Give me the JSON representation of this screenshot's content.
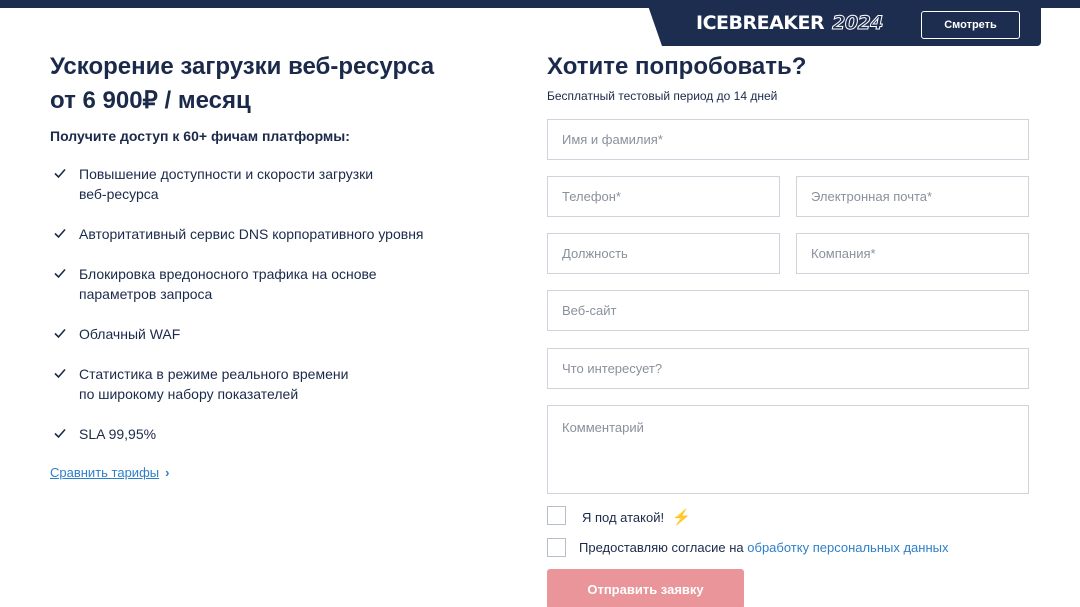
{
  "banner": {
    "logo_text": "ICEBREAKER",
    "logo_year": "2024",
    "watch_label": "Смотреть"
  },
  "offer": {
    "title_line1": "Ускорение загрузки веб-ресурса",
    "title_line2": "от 6 900₽ / месяц",
    "features_heading": "Получите доступ к 60+ фичам платформы:",
    "features": [
      [
        "Повышение доступности и скорости загрузки",
        "веб-ресурса"
      ],
      [
        "Авторитативный сервис DNS корпоративного уровня"
      ],
      [
        "Блокировка вредоносного трафика на основе",
        "параметров запроса"
      ],
      [
        "Облачный WAF"
      ],
      [
        "Статистика в режиме реального времени",
        "по широкому набору показателей"
      ],
      [
        "SLA 99,95%"
      ]
    ],
    "compare_link": "Сравнить тарифы",
    "compare_chevron": "›"
  },
  "form": {
    "title": "Хотите попробовать?",
    "subtitle": "Бесплатный тестовый период до 14 дней",
    "fields": {
      "name": "Имя и фамилия*",
      "phone": "Телефон*",
      "email": "Электронная почта*",
      "position": "Должность",
      "company": "Компания*",
      "website": "Веб-сайт",
      "interest": "Что интересует?",
      "comment": "Комментарий"
    },
    "attack_label": "Я под атакой!",
    "attack_icon": "⚡",
    "consent_text": "Предоставляю согласие на",
    "consent_link": "обработку персональных данных",
    "submit_label": "Отправить заявку"
  },
  "colors": {
    "navy": "#1c2d4f",
    "link": "#2e7fc9",
    "submit": "#e9959a",
    "alert": "#e23b3b"
  }
}
